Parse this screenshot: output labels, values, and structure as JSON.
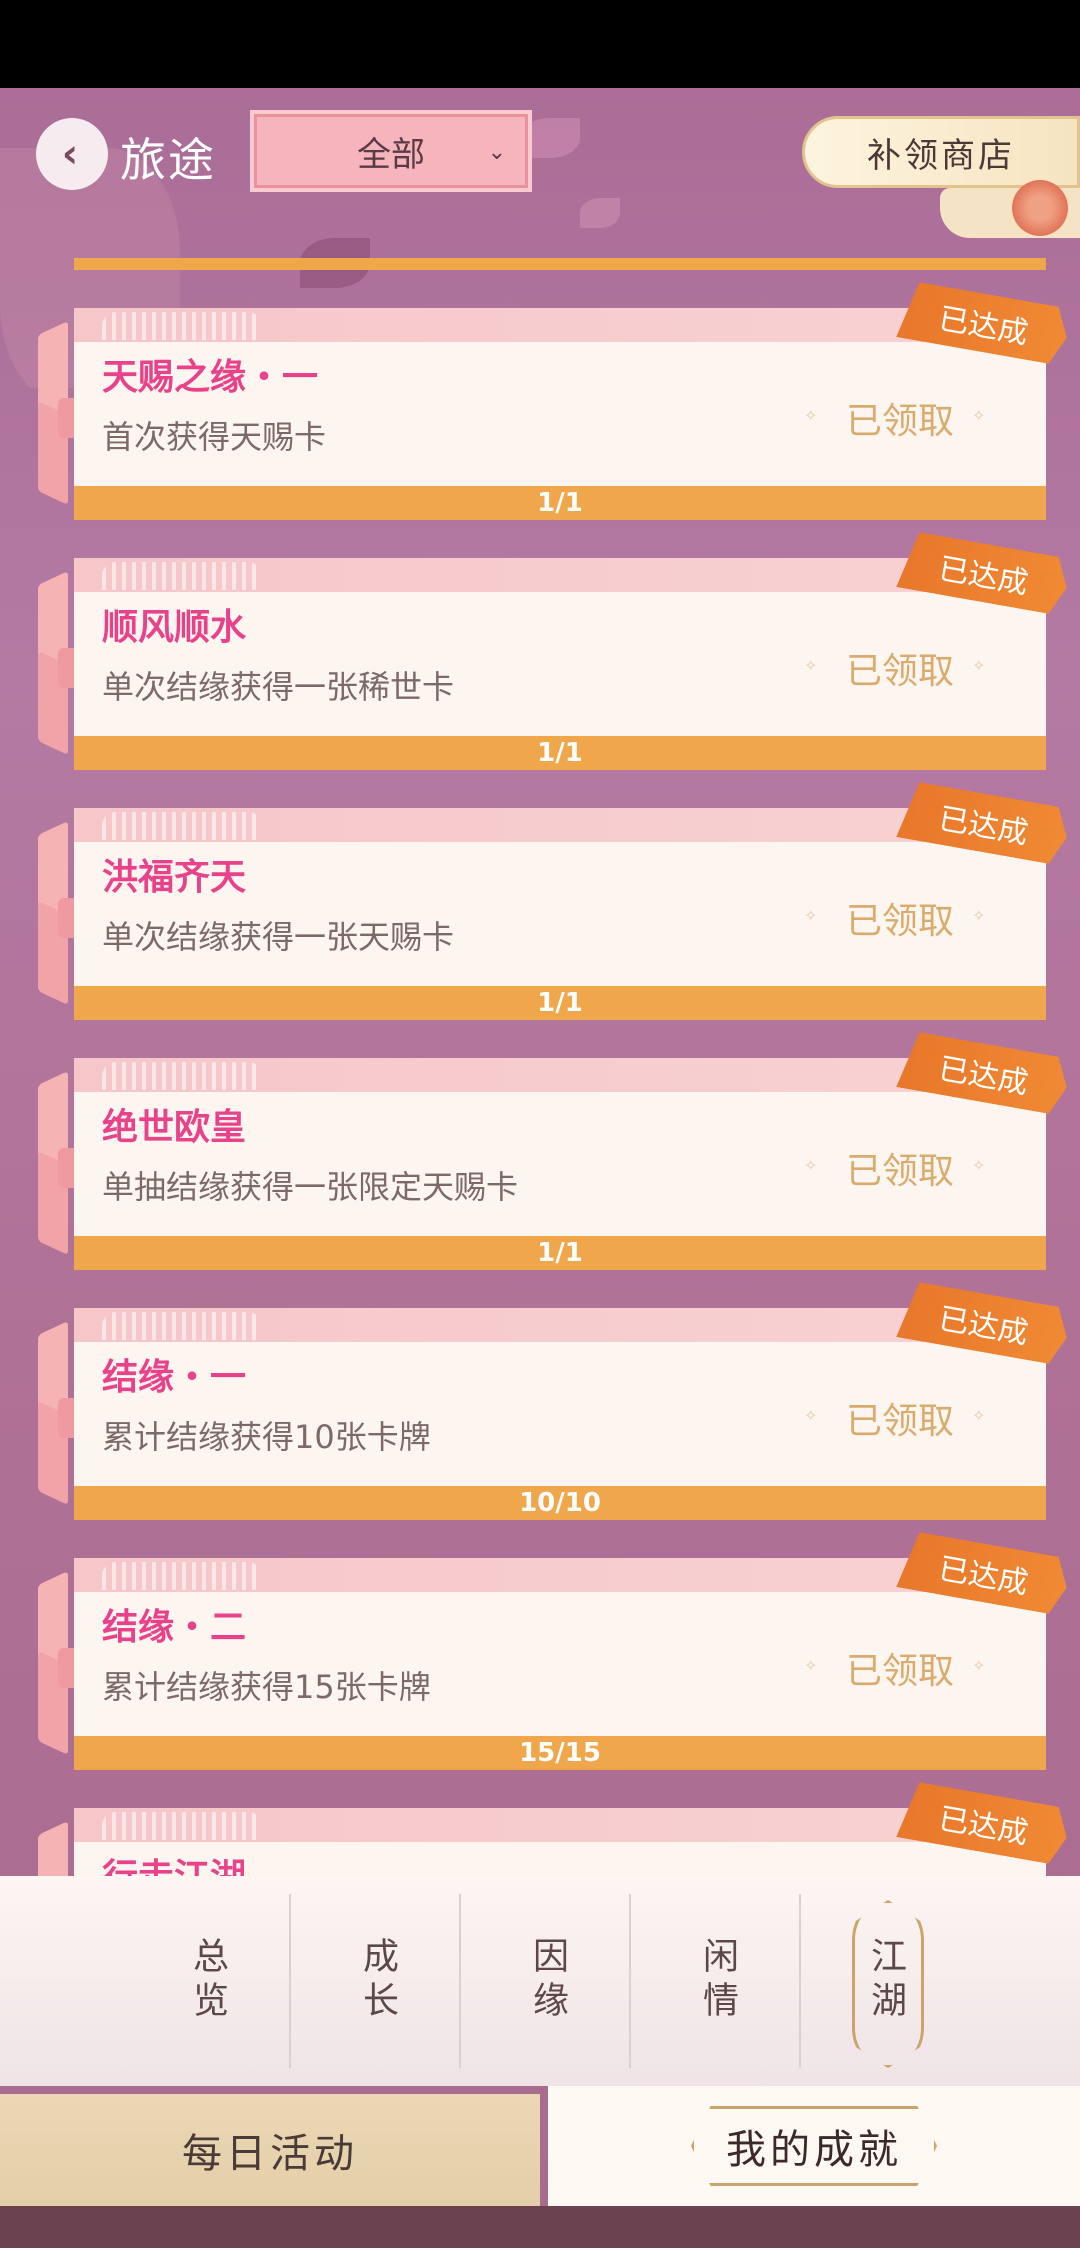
{
  "header": {
    "title": "旅途",
    "filter_value": "全部",
    "shop_label": "补领商店"
  },
  "list": {
    "badge_label": "已达成",
    "claimed_label": "已领取",
    "items": [
      {
        "name": "天赐之缘・一",
        "desc": "首次获得天赐卡",
        "progress": "1/1"
      },
      {
        "name": "顺风顺水",
        "desc": "单次结缘获得一张稀世卡",
        "progress": "1/1"
      },
      {
        "name": "洪福齐天",
        "desc": "单次结缘获得一张天赐卡",
        "progress": "1/1"
      },
      {
        "name": "绝世欧皇",
        "desc": "单抽结缘获得一张限定天赐卡",
        "progress": "1/1"
      },
      {
        "name": "结缘・一",
        "desc": "累计结缘获得10张卡牌",
        "progress": "10/10"
      },
      {
        "name": "结缘・二",
        "desc": "累计结缘获得15张卡牌",
        "progress": "15/15"
      },
      {
        "name": "行走江湖",
        "desc": "",
        "progress": ""
      }
    ]
  },
  "tabs": [
    {
      "label": "总览"
    },
    {
      "label": "成长"
    },
    {
      "label": "因缘"
    },
    {
      "label": "闲情"
    },
    {
      "label": "江湖"
    }
  ],
  "active_tab": "江湖",
  "bottom": {
    "daily_label": "每日活动",
    "mine_label": "我的成就"
  },
  "colors": {
    "accent_pink": "#e8428a",
    "progress_orange": "#f0a74c",
    "badge_orange": "#e8772a",
    "claimed_gold": "#d9ab6d"
  }
}
